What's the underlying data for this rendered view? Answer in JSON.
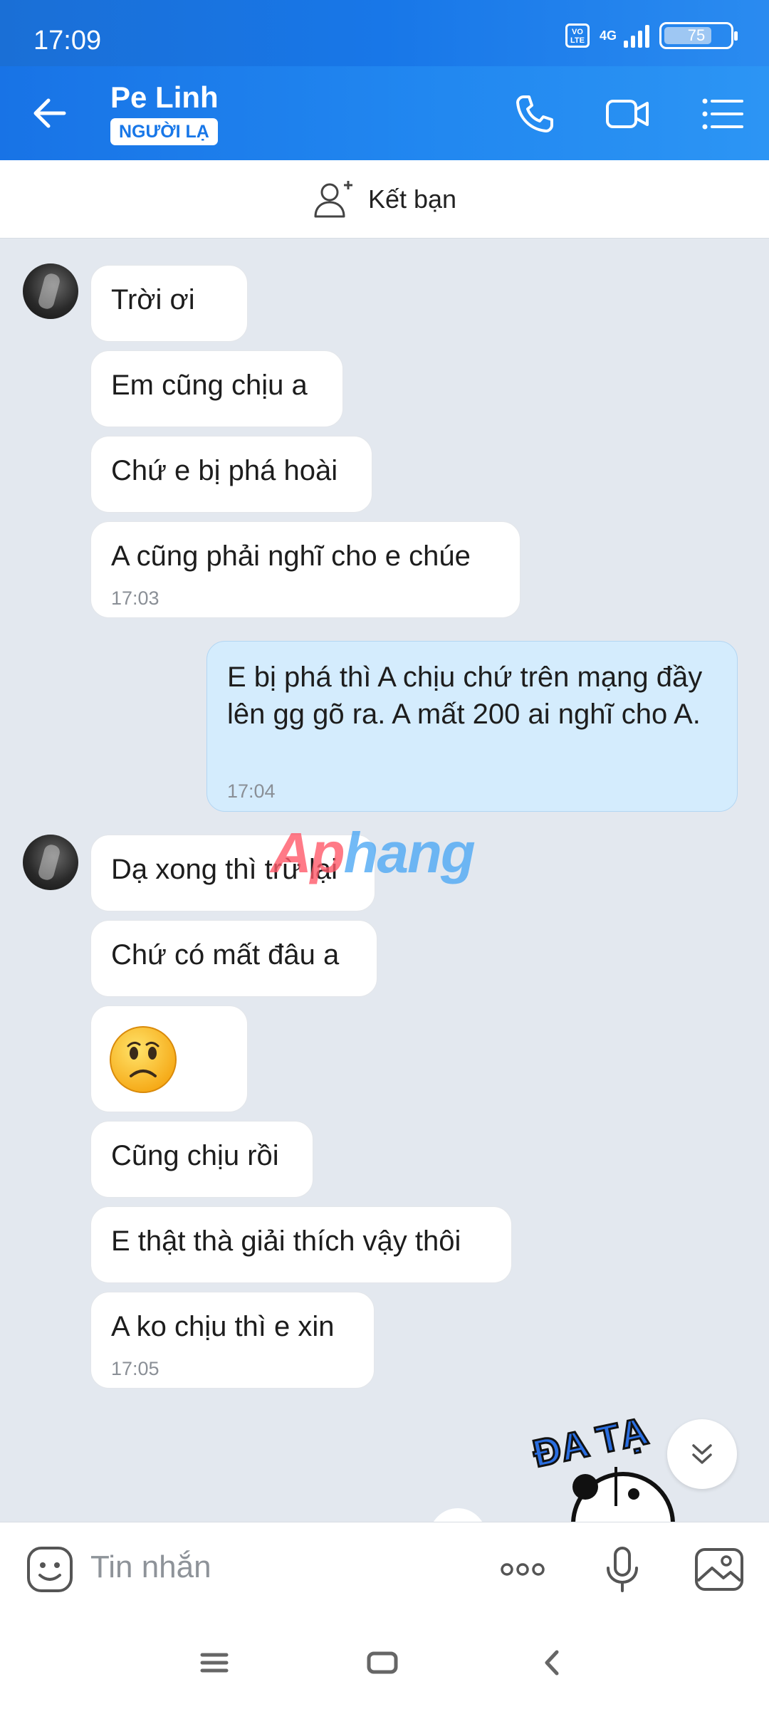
{
  "status_bar": {
    "time": "17:09",
    "volte": "VO LTE",
    "network": "4G",
    "battery": "75"
  },
  "header": {
    "contact_name": "Pe Linh",
    "badge": "NGƯỜI LẠ"
  },
  "friend_bar": {
    "label": "Kết bạn"
  },
  "messages": [
    {
      "text": "Trời ơi"
    },
    {
      "text": "Em cũng chịu a"
    },
    {
      "text": "Chứ e bị phá hoài"
    },
    {
      "text": "A cũng phải nghĩ cho e chúe",
      "time": "17:03"
    },
    {
      "text": "E bị phá thì A chịu chứ trên mạng đầy lên gg gõ ra. A mất 200 ai nghĩ cho A.",
      "time": "17:04"
    },
    {
      "text": "Dạ xong thì trừ lại"
    },
    {
      "text": "Chứ có mất đâu a"
    },
    {
      "emoji": "frowning-face"
    },
    {
      "text": "Cũng chịu rồi"
    },
    {
      "text": "E thật thà giải thích vậy thôi"
    },
    {
      "text": "A ko chịu thì e xin",
      "time": "17:05"
    }
  ],
  "watermark": {
    "part1": "Ap",
    "part2": "hang"
  },
  "sticker": {
    "text": "ĐA TẠ"
  },
  "input_bar": {
    "placeholder": "Tin nhắn"
  },
  "colors": {
    "header": "#1877e8",
    "mine_bubble": "#d4ecfd",
    "background": "#e3e8ef"
  }
}
